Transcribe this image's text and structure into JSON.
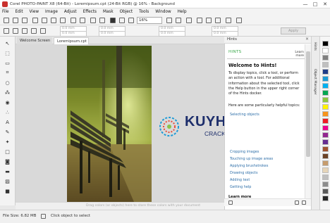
{
  "window": {
    "title": "Corel PHOTO-PAINT X8 (64-Bit) - Loremipsum.cpt (24-Bit RGB) @ 16% - Background",
    "controls": [
      "—",
      "□",
      "✕"
    ]
  },
  "menu": [
    "File",
    "Edit",
    "View",
    "Image",
    "Adjust",
    "Effects",
    "Mask",
    "Object",
    "Tools",
    "Window",
    "Help"
  ],
  "toolbar": {
    "zoom": "16%"
  },
  "propbar": {
    "fields": [
      "0.0 mm",
      "0.0 mm",
      "0.0 mm",
      "0.0 mm",
      "0.0 mm",
      "0.0 mm",
      "0.0 mm",
      "0.0 mm"
    ],
    "apply_label": "Apply"
  },
  "tabs": [
    "Welcome Screen",
    "Loremipsum.cpt"
  ],
  "canvas": {
    "hint": "Drag colors (or objects) here to store these colors with your document"
  },
  "status": {
    "file_size": "File Size: 6.82 MB",
    "message": "Click object to select"
  },
  "docker": {
    "title": "Hints",
    "close": "×",
    "tag": "HINTS",
    "learn_more_top": "Learn more",
    "welcome": "Welcome to Hints!",
    "intro": "To display topics, click a tool, or perform an action with a tool. For additional information about the selected tool, click the Help button in the upper right corner of the Hints docker.",
    "topics_heading": "Here are some particularly helpful topics:",
    "topics": [
      "Selecting objects",
      "Cropping images",
      "Touching up image areas",
      "Applying brushstrokes",
      "Drawing objects",
      "Adding text",
      "Getting help"
    ],
    "learn_more_bottom": "Learn more"
  },
  "side_tabs": [
    "Hints",
    "Object Manager"
  ],
  "palette_colors": [
    "#000000",
    "#ffffff",
    "#7f7f7f",
    "#c0c0c0",
    "#1f3c88",
    "#1c9bd6",
    "#00b0f0",
    "#00a651",
    "#8dc63f",
    "#fff200",
    "#f7941d",
    "#ed1c24",
    "#ec008c",
    "#92278f",
    "#662d91",
    "#a0522d",
    "#6b4226",
    "#c69c6d",
    "#e6d5b8",
    "#bfbfbf",
    "#8c8c8c",
    "#595959",
    "#262626"
  ],
  "watermark": {
    "line1": "KUYHAA",
    "line2": "CRACKS.COM"
  }
}
